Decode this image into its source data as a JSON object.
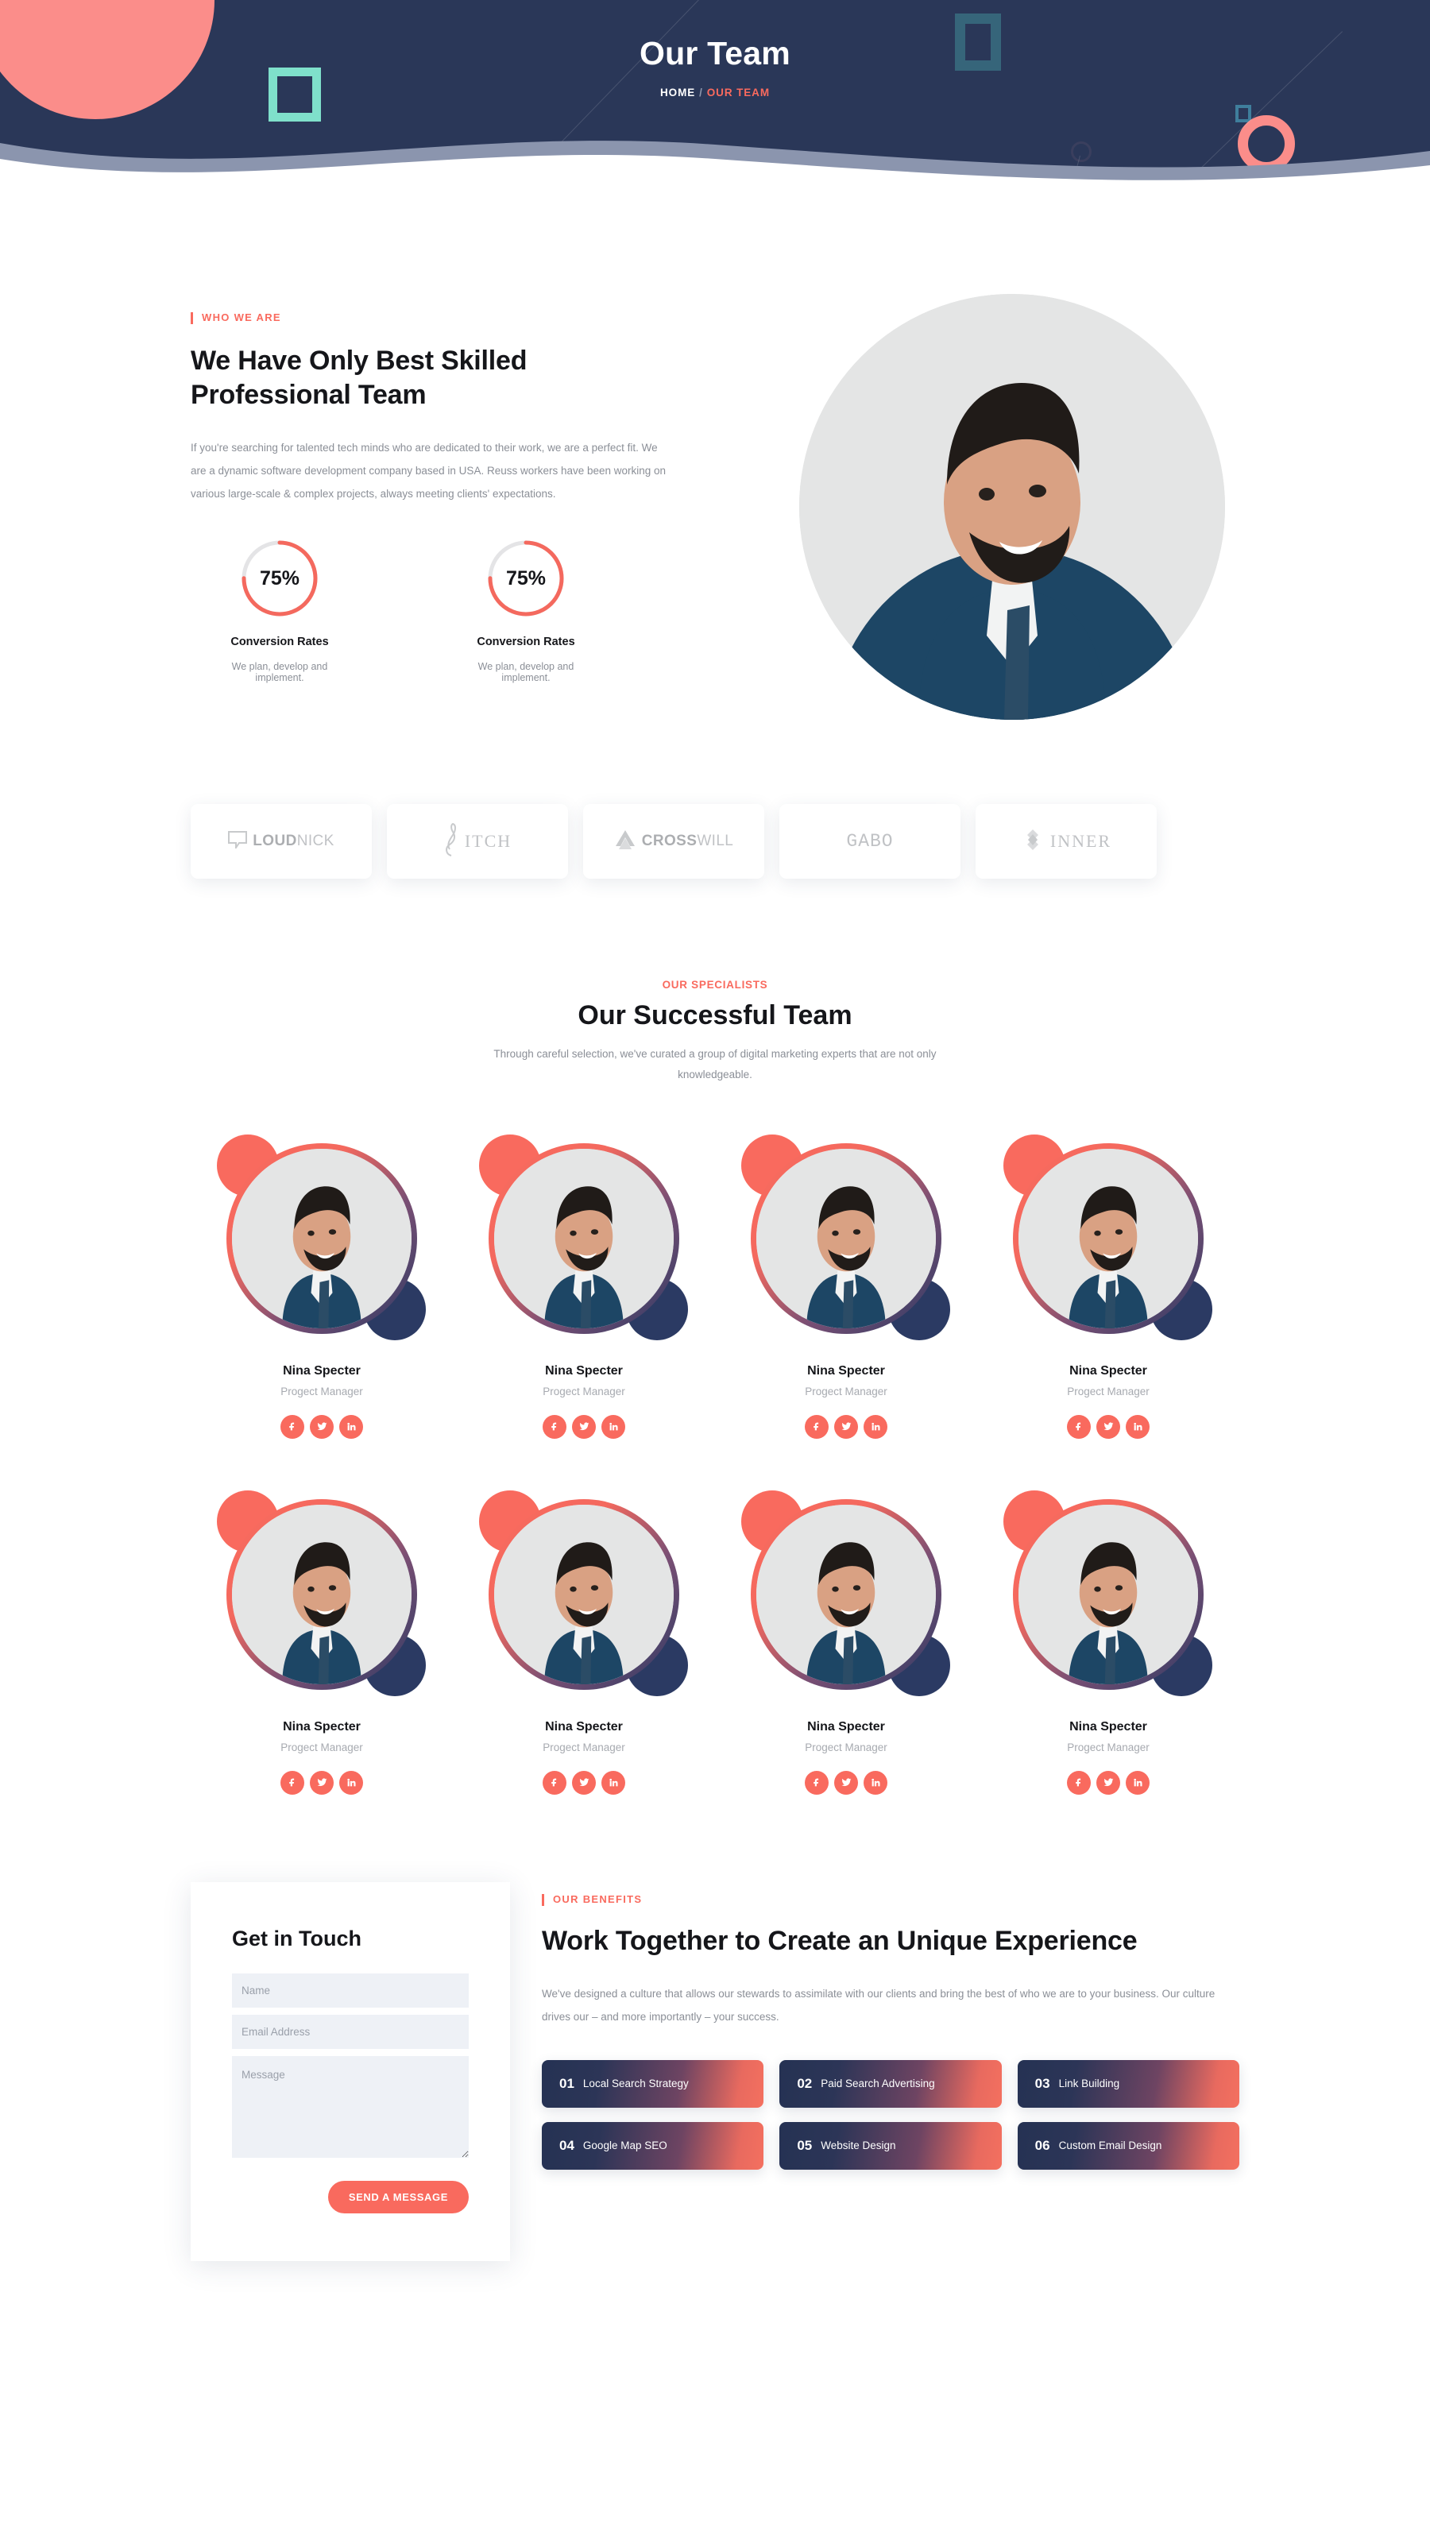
{
  "banner": {
    "title": "Our Team",
    "breadcrumb": {
      "home": "HOME",
      "separator": "/",
      "current": "OUR TEAM"
    }
  },
  "who_we_are": {
    "eyebrow": "WHO WE ARE",
    "heading": "We Have Only Best Skilled Professional Team",
    "paragraph": "If you're searching for talented tech minds who are dedicated to their work, we are a perfect fit. We are a dynamic software development company based in USA. Reuss workers have been working on various large-scale & complex projects, always meeting clients' expectations.",
    "stats": [
      {
        "percent": "75%",
        "value": 75,
        "title": "Conversion Rates",
        "desc": "We plan, develop and implement."
      },
      {
        "percent": "75%",
        "value": 75,
        "title": "Conversion Rates",
        "desc": "We plan, develop and implement."
      }
    ]
  },
  "partners": [
    {
      "name": "LOUDNICK",
      "bold": "LOUD",
      "rest": "NICK",
      "style": "badge"
    },
    {
      "name": "PITCH",
      "bold": "",
      "rest": "ITCH",
      "style": "clef"
    },
    {
      "name": "CROSSWILL",
      "bold": "CROSS",
      "rest": "WILL",
      "style": "chevron"
    },
    {
      "name": "GABO",
      "bold": "",
      "rest": "GABO",
      "style": "mono"
    },
    {
      "name": "INNER",
      "bold": "",
      "rest": "INNER",
      "style": "diamond"
    }
  ],
  "team": {
    "eyebrow": "OUR SPECIALISTS",
    "heading": "Our Successful Team",
    "subtext": "Through careful selection, we've curated a group of digital marketing experts that are not only knowledgeable.",
    "members": [
      {
        "name": "Nina Specter",
        "role": "Progect Manager"
      },
      {
        "name": "Nina Specter",
        "role": "Progect Manager"
      },
      {
        "name": "Nina Specter",
        "role": "Progect Manager"
      },
      {
        "name": "Nina Specter",
        "role": "Progect Manager"
      },
      {
        "name": "Nina Specter",
        "role": "Progect Manager"
      },
      {
        "name": "Nina Specter",
        "role": "Progect Manager"
      },
      {
        "name": "Nina Specter",
        "role": "Progect Manager"
      },
      {
        "name": "Nina Specter",
        "role": "Progect Manager"
      }
    ],
    "social_icons": [
      "facebook-icon",
      "twitter-icon",
      "linkedin-icon"
    ]
  },
  "contact": {
    "title": "Get in Touch",
    "name_placeholder": "Name",
    "name_value": "",
    "email_placeholder": "Email Address",
    "email_value": "",
    "message_placeholder": "Message",
    "message_value": "",
    "submit_label": "SEND A MESSAGE"
  },
  "benefits": {
    "eyebrow": "OUR BENEFITS",
    "heading": "Work Together to Create an Unique Experience",
    "paragraph": "We've designed a culture that allows our stewards to assimilate with our clients and bring the best of who we are to your business. Our culture drives our – and more importantly – your success.",
    "items": [
      {
        "num": "01",
        "label": "Local Search Strategy"
      },
      {
        "num": "02",
        "label": "Paid Search Advertising"
      },
      {
        "num": "03",
        "label": "Link Building"
      },
      {
        "num": "04",
        "label": "Google Map SEO"
      },
      {
        "num": "05",
        "label": "Website Design"
      },
      {
        "num": "06",
        "label": "Custom Email Design"
      }
    ]
  },
  "colors": {
    "navy": "#2a3758",
    "coral": "#f96a5e",
    "coral_light": "#fb8d8a",
    "mint": "#7fe0cb",
    "teal": "#36657a",
    "text_dark": "#15161a",
    "text_muted": "#8b8f97",
    "field_bg": "#eef1f6"
  }
}
